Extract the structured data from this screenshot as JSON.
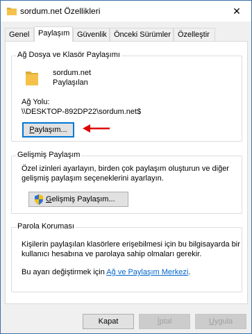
{
  "window": {
    "title": "sordum.net Özellikleri",
    "close_symbol": "✕"
  },
  "tabs": [
    {
      "label": "Genel"
    },
    {
      "label": "Paylaşım"
    },
    {
      "label": "Güvenlik"
    },
    {
      "label": "Önceki Sürümler"
    },
    {
      "label": "Özelleştir"
    }
  ],
  "file_sharing": {
    "legend": "Ağ Dosya ve Klasör Paylaşımı",
    "folder_name": "sordum.net",
    "folder_status": "Paylaşılan",
    "path_label_first": "A",
    "path_label_underlined": "ğ",
    "path_label_rest": " Yolu:",
    "path_value": "\\\\DESKTOP-892DP22\\sordum.net$",
    "share_button": {
      "underlined": "P",
      "rest": "aylaşım..."
    }
  },
  "advanced_sharing": {
    "legend": "Gelişmiş Paylaşım",
    "description_line1": "Özel izinleri ayarlayın, birden çok paylaşım oluşturun ve diğer",
    "description_line2": "gelişmiş paylaşım seçeneklerini ayarlayın.",
    "button": {
      "underlined": "G",
      "rest": "elişmiş Paylaşım..."
    }
  },
  "password_protection": {
    "legend": "Parola Koruması",
    "description_line1": "Kişilerin paylaşılan klasörlere erişebilmesi için bu bilgisayarda bir",
    "description_line2": "kullanıcı hesabına ve parolaya sahip olmaları gerekir.",
    "change_prefix": "Bu ayarı değiştirmek için ",
    "link_text": "Ağ ve Paylaşım Merkezi",
    "change_suffix": "."
  },
  "footer": {
    "ok": "Kapat",
    "cancel": {
      "underlined": "İ",
      "rest": "ptal"
    },
    "apply": {
      "underlined": "U",
      "rest": "ygula"
    }
  },
  "colors": {
    "accent": "#0078d7",
    "link": "#0066cc",
    "arrow": "#e00000",
    "folder": "#f4c24a"
  }
}
